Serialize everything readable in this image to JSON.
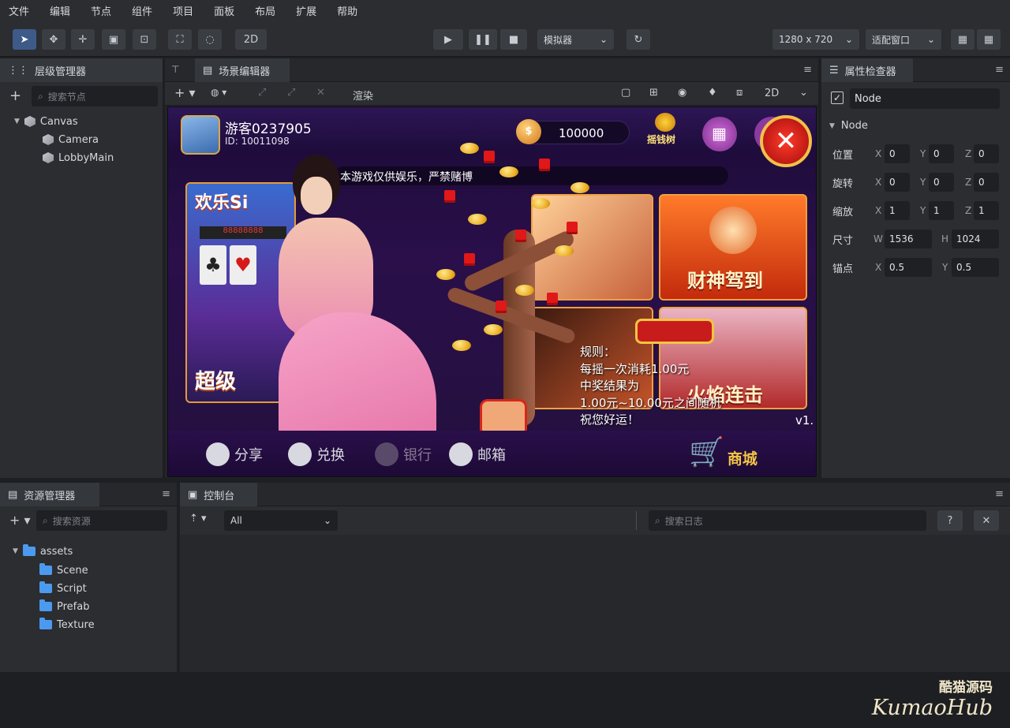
{
  "menu": [
    "文件",
    "编辑",
    "节点",
    "组件",
    "项目",
    "面板",
    "布局",
    "扩展",
    "帮助"
  ],
  "toolbar": {
    "mode_2d": "2D",
    "preview_target": "模拟器",
    "resolution": "1280 x 720",
    "fit_mode": "适配窗口"
  },
  "hierarchy": {
    "title": "层级管理器",
    "search_placeholder": "搜索节点",
    "nodes": [
      {
        "label": "Canvas",
        "level": 0
      },
      {
        "label": "Camera",
        "level": 1
      },
      {
        "label": "LobbyMain",
        "level": 1
      }
    ]
  },
  "scene": {
    "tab_label": "场景编辑器",
    "render_label": "渲染",
    "view_mode": "2D"
  },
  "game": {
    "player_name": "游客0237905",
    "player_id": "ID: 10011098",
    "coins": "100000",
    "tree_label": "摇钱树",
    "marquee": "本游戏仅供娱乐，严禁赌博",
    "card_top_left": "欢乐Si",
    "card_bottom_left": "超级",
    "card_god": "财神驾到",
    "card_fire": "火焰连击",
    "rules": [
      "规则：",
      "每摇一次消耗1.00元",
      "中奖结果为",
      "1.00元~10.00元之间随机",
      "祝您好运！"
    ],
    "version": "v1.",
    "slot_digits": "88888888",
    "bottom_nav": [
      "分享",
      "兑换",
      "银行",
      "邮箱"
    ],
    "shop": "商城"
  },
  "inspector": {
    "title": "属性检查器",
    "node_name": "Node",
    "section": "Node",
    "position": {
      "label": "位置",
      "x": "0",
      "y": "0",
      "z": "0"
    },
    "rotation": {
      "label": "旋转",
      "x": "0",
      "y": "0",
      "z": "0"
    },
    "scale": {
      "label": "缩放",
      "x": "1",
      "y": "1",
      "z": "1"
    },
    "size": {
      "label": "尺寸",
      "w": "1536",
      "h": "1024"
    },
    "anchor": {
      "label": "锚点",
      "x": "0.5",
      "y": "0.5"
    }
  },
  "assets": {
    "title": "资源管理器",
    "search_placeholder": "搜索资源",
    "root": "assets",
    "folders": [
      "Scene",
      "Script",
      "Prefab",
      "Texture"
    ]
  },
  "console": {
    "title": "控制台",
    "filter": "All",
    "search_placeholder": "搜索日志"
  },
  "watermark": {
    "cn": "酷猫源码",
    "en": "KumaoHub"
  },
  "colors": {
    "accent": "#3d5a88",
    "folder": "#4c9af0",
    "gold": "#f5c542"
  }
}
